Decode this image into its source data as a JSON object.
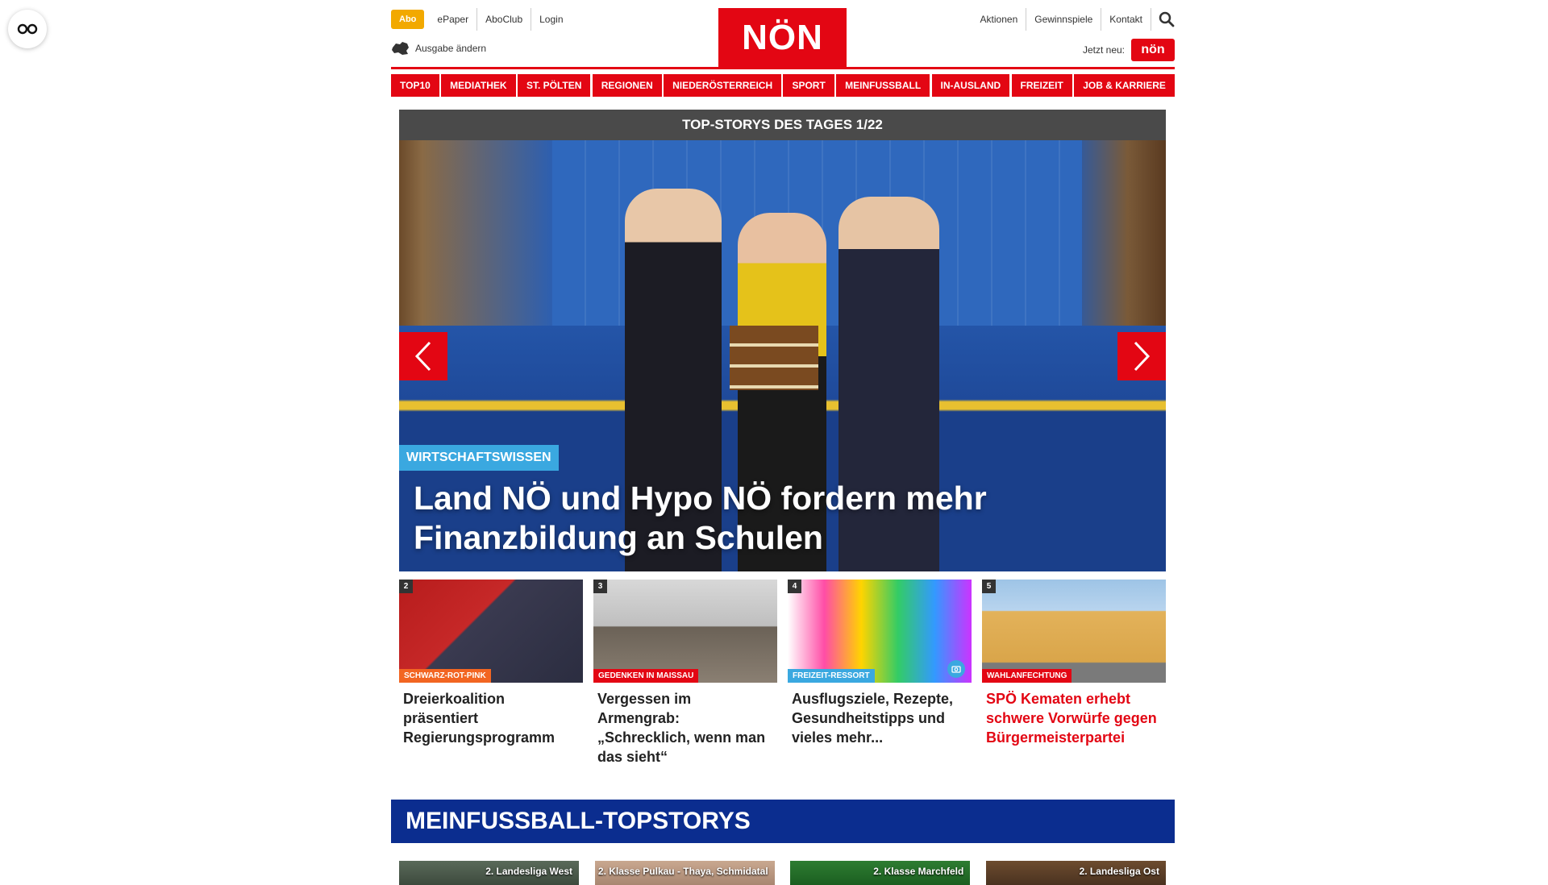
{
  "topbar": {
    "abo": "Abo",
    "links_left": [
      "ePaper",
      "AboClub",
      "Login"
    ],
    "edition": "Ausgabe ändern",
    "logo": "NÖN",
    "links_right": [
      "Aktionen",
      "Gewinnspiele",
      "Kontakt"
    ],
    "jetzt_neu": "Jetzt neu:",
    "mini_logo": "nön"
  },
  "nav": [
    "TOP10",
    "MEDIATHEK",
    "ST. PÖLTEN",
    "REGIONEN",
    "NIEDERÖSTERREICH",
    "SPORT",
    "MEINFUSSBALL",
    "IN-AUSLAND",
    "FREIZEIT",
    "JOB & KARRIERE"
  ],
  "hero": {
    "header": "TOP-STORYS DES TAGES 1/22",
    "kicker": "WIRTSCHAFTSWISSEN",
    "title": "Land NÖ und Hypo NÖ fordern mehr Finanzbildung an Schulen"
  },
  "cards": [
    {
      "num": "2",
      "tag": "SCHWARZ-ROT-PINK",
      "tag_color": "#f26522",
      "title": "Dreierkoalition präsentiert Regierungsprogramm",
      "red": false
    },
    {
      "num": "3",
      "tag": "GEDENKEN IN MAISSAU",
      "tag_color": "#e30613",
      "title": "Vergessen im Armengrab: „Schrecklich, wenn man das sieht“",
      "red": false
    },
    {
      "num": "4",
      "tag": "FREIZEIT-RESSORT",
      "tag_color": "#3aa8e0",
      "title": "Ausflugsziele, Rezepte, Gesundheitstipps und vieles mehr...",
      "red": false
    },
    {
      "num": "5",
      "tag": "WAHLANFECHTUNG",
      "tag_color": "#e30613",
      "title": "SPÖ Kematen erhebt schwere Vorwürfe gegen Bürgermeisterpartei",
      "red": true
    }
  ],
  "meinfussball": {
    "title": "MEINFUSSBALL-TOPSTORYS",
    "cards": [
      "2. Landesliga West",
      "2. Klasse Pulkau - Thaya, Schmidatal",
      "2. Klasse Marchfeld",
      "2. Landesliga Ost"
    ]
  },
  "colors": {
    "brand_red": "#e30613",
    "abo_yellow": "#f2a900",
    "fussball_blue": "#0b2d8f"
  }
}
